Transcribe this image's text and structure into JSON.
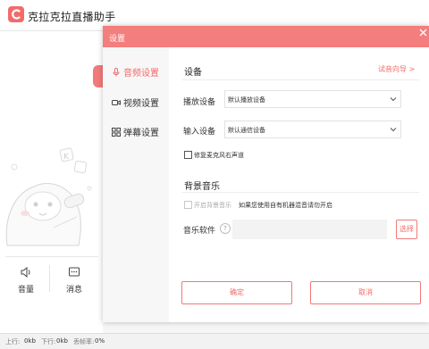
{
  "main_window": {
    "title": "克拉克拉直播助手",
    "tools": [
      {
        "label": "音量",
        "icon": "speaker-icon"
      },
      {
        "label": "消息",
        "icon": "message-icon"
      }
    ],
    "status": {
      "upload_label": "上行:",
      "upload_value": "0kb",
      "download_label": "下行:",
      "download_value": "0kb",
      "drop_label": "丢帧率:",
      "drop_value": "0%"
    }
  },
  "dialog": {
    "title": "设置",
    "nav": [
      {
        "label": "音频设置",
        "icon": "microphone-icon",
        "active": true
      },
      {
        "label": "视频设置",
        "icon": "camera-icon",
        "active": false
      },
      {
        "label": "弹幕设置",
        "icon": "grid-icon",
        "active": false
      }
    ],
    "device_section": {
      "title": "设备",
      "guide_link": "试音向导 >",
      "playback_label": "播放设备",
      "playback_value": "默认播放设备",
      "input_label": "输入设备",
      "input_value": "默认通信设备",
      "fix_mic_label": "修复麦克风右声道",
      "fix_mic_checked": false
    },
    "music_section": {
      "title": "背景音乐",
      "enable_label": "开启背景音乐",
      "enable_checked": false,
      "hint": "如果您使用自有机器混音请勿开启",
      "software_label": "音乐软件",
      "software_value": "",
      "browse_label": "选择"
    },
    "ok_label": "确定",
    "cancel_label": "取消"
  },
  "colors": {
    "accent": "#f47d7d",
    "accent_text": "#f26b6b"
  }
}
